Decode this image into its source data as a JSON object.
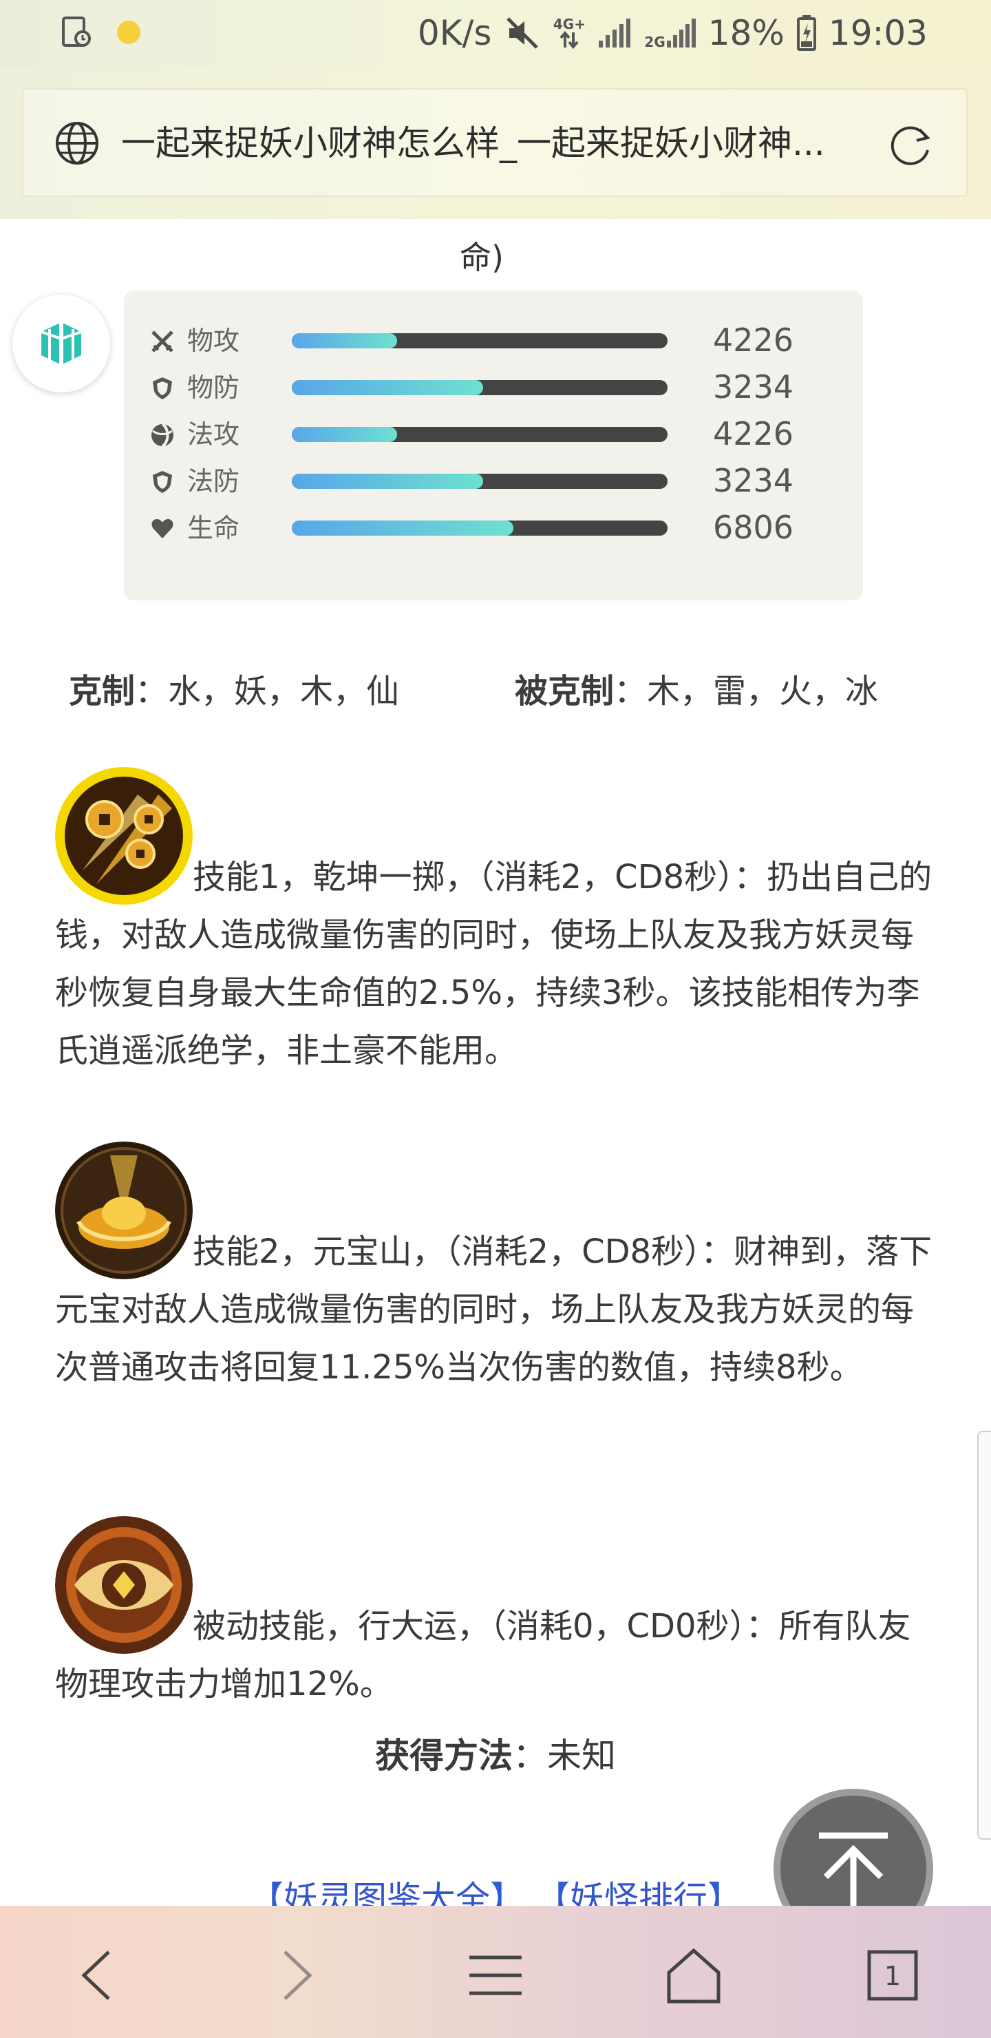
{
  "status_bar": {
    "net_speed": "0K/s",
    "net_type_1": "4G+",
    "net_type_2": "2G",
    "battery": "18%",
    "time": "19:03"
  },
  "address_bar": {
    "title": "一起来捉妖小财神怎么样_一起来捉妖小财神..."
  },
  "article": {
    "caption_tail": "命)",
    "stats": [
      {
        "icon": "sword-icon",
        "label": "物攻",
        "value": "4226",
        "fill_fraction": 0.28
      },
      {
        "icon": "shield-icon",
        "label": "物防",
        "value": "3234",
        "fill_fraction": 0.51
      },
      {
        "icon": "orb-icon",
        "label": "法攻",
        "value": "4226",
        "fill_fraction": 0.28
      },
      {
        "icon": "shield-icon",
        "label": "法防",
        "value": "3234",
        "fill_fraction": 0.51
      },
      {
        "icon": "heart-icon",
        "label": "生命",
        "value": "6806",
        "fill_fraction": 0.59
      }
    ],
    "counters_label": "克制",
    "counters_value": "：水，妖，木，仙",
    "countered_label": "被克制",
    "countered_value": "：木，雷，火，冰",
    "skills": [
      {
        "icon": "coins-skill-icon",
        "text": "技能1，乾坤一掷，（消耗2，CD8秒）：扔出自己的钱，对敌人造成微量伤害的同时，使场上队友及我方妖灵每秒恢复自身最大生命值的2.5%，持续3秒。该技能相传为李氏逍遥派绝学，非土豪不能用。"
      },
      {
        "icon": "ingot-skill-icon",
        "text": "技能2，元宝山，（消耗2，CD8秒）：财神到，落下元宝对敌人造成微量伤害的同时，场上队友及我方妖灵的每次普通攻击将回复11.25%当次伤害的数值，持续8秒。"
      },
      {
        "icon": "eye-skill-icon",
        "text": "被动技能，行大运，（消耗0，CD0秒）：所有队友物理攻击力增加12%。"
      }
    ],
    "acquire_label": "获得方法",
    "acquire_value": "：未知",
    "links": [
      "妖灵图鉴大全",
      "妖怪排行"
    ]
  },
  "bottom_nav": {
    "tab_count": "1"
  },
  "colors": {
    "bar_fill_start": "#58a6e8",
    "bar_fill_end": "#6fe0d0",
    "bar_track": "#444444",
    "link": "#3355cc"
  }
}
